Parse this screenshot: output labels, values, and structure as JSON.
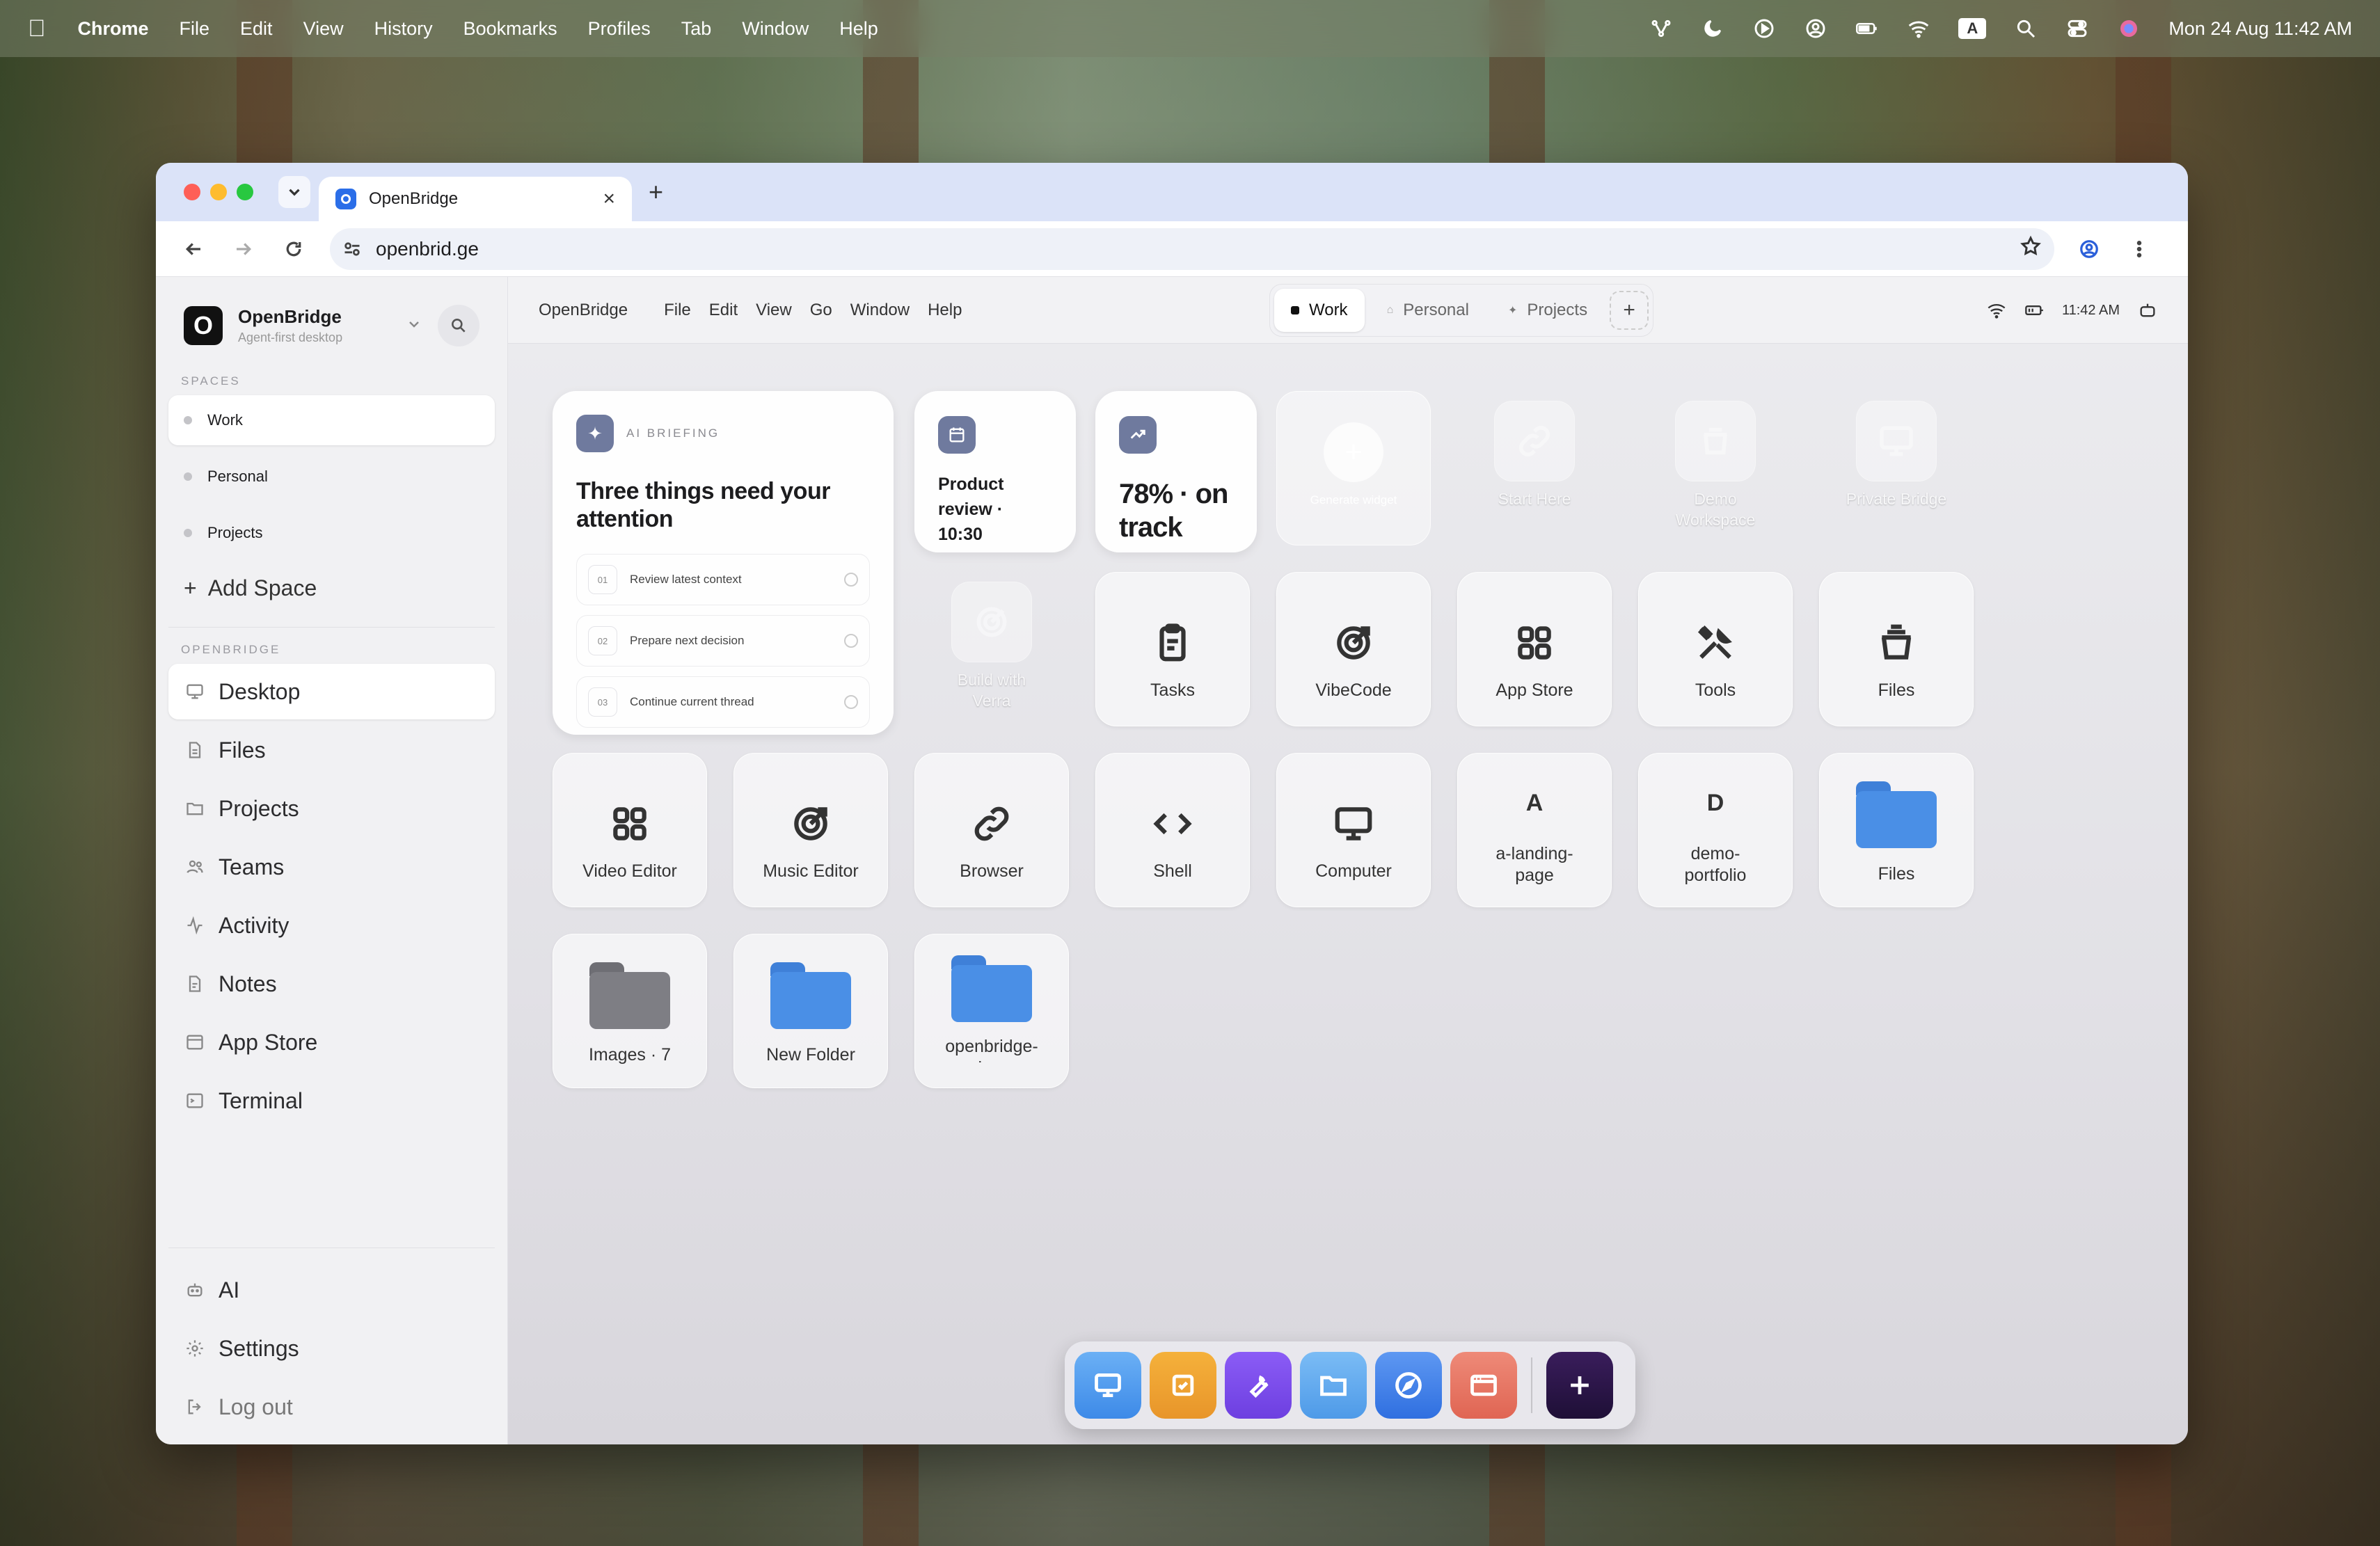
{
  "menubar": {
    "app": "Chrome",
    "items": [
      "File",
      "Edit",
      "View",
      "History",
      "Bookmarks",
      "Profiles",
      "Tab",
      "Window",
      "Help"
    ],
    "datetime": "Mon 24 Aug  11:42 AM",
    "keyboard": "A"
  },
  "browser": {
    "tab_title": "OpenBridge",
    "url": "openbrid.ge"
  },
  "sidebar": {
    "brand": "OpenBridge",
    "tagline": "Agent-first desktop",
    "spaces_header": "SPACES",
    "spaces": [
      "Work",
      "Personal",
      "Projects"
    ],
    "add_space": "Add Space",
    "section_header": "OPENBRIDGE",
    "nav": [
      "Desktop",
      "Files",
      "Projects",
      "Teams",
      "Activity",
      "Notes",
      "App Store",
      "Terminal"
    ],
    "bottom": [
      "AI",
      "Settings",
      "Log out"
    ]
  },
  "topbar": {
    "app": "OpenBridge",
    "menus": [
      "File",
      "Edit",
      "View",
      "Go",
      "Window",
      "Help"
    ],
    "spaces": [
      "Work",
      "Personal",
      "Projects"
    ],
    "time": "11:42 AM"
  },
  "briefing": {
    "tag": "AI BRIEFING",
    "title": "Three things need your attention",
    "items": [
      {
        "n": "01",
        "t": "Review latest context"
      },
      {
        "n": "02",
        "t": "Prepare next decision"
      },
      {
        "n": "03",
        "t": "Continue current thread"
      }
    ]
  },
  "widgets": {
    "calendar": "Product review · 10:30",
    "progress": "78% · on track",
    "generate": "Generate widget"
  },
  "ghost_apps": [
    "Start Here",
    "Demo Workspace",
    "Private Bridge",
    "Build with Verra"
  ],
  "apps_row1": [
    "Tasks",
    "VibeCode",
    "App Store",
    "Tools",
    "Files"
  ],
  "apps_row2": [
    "Video Editor",
    "Music Editor",
    "Browser",
    "Shell",
    "Computer"
  ],
  "letter_apps": [
    {
      "letter": "A",
      "label": "a-landing-page"
    },
    {
      "letter": "D",
      "label": "demo-portfolio"
    }
  ],
  "folders": [
    {
      "label": "Files",
      "color": "#4a8fe6"
    },
    {
      "label": "Images · 7",
      "color": "#7e7e84"
    },
    {
      "label": "New Folder",
      "color": "#4a8fe6"
    },
    {
      "label": "openbridge-workspace",
      "color": "#4a8fe6"
    }
  ]
}
